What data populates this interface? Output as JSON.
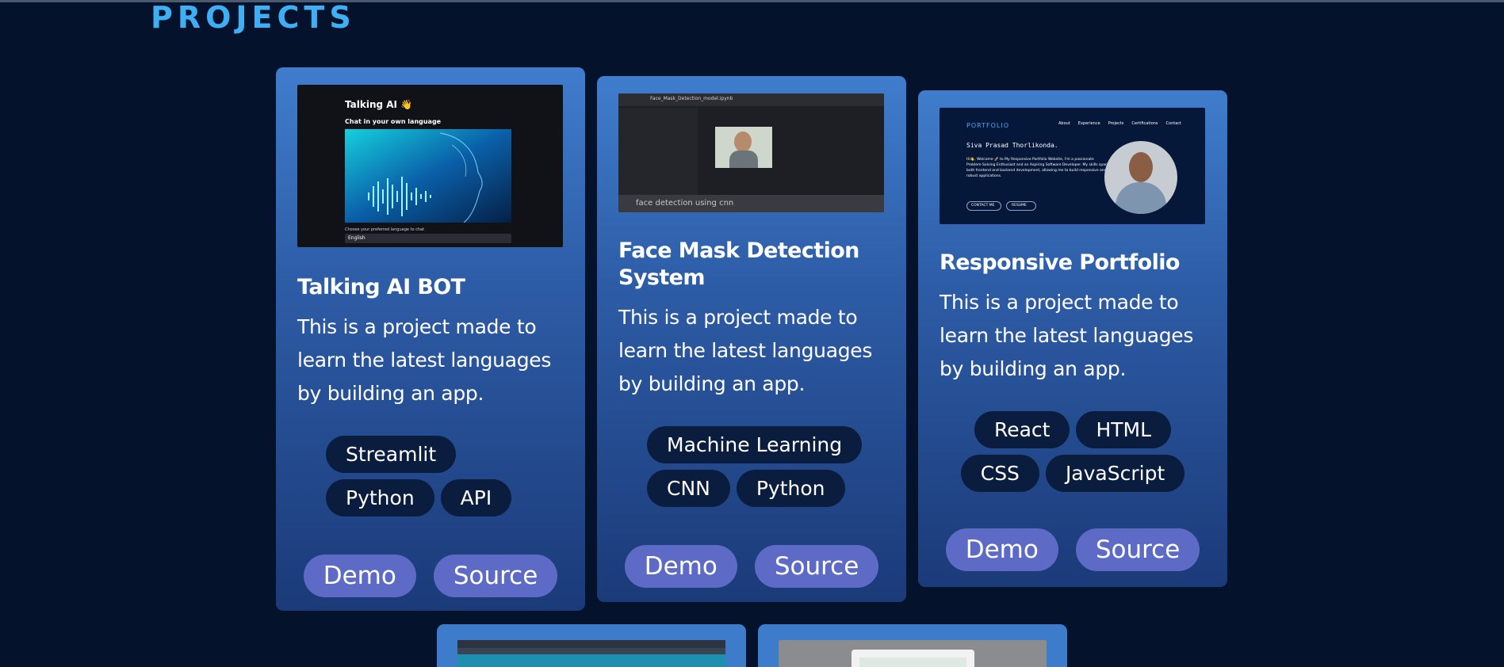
{
  "section": {
    "title": "PROJECTS"
  },
  "projects": [
    {
      "title": "Talking AI BOT",
      "description": "This is a project made to learn the latest languages by building an app.",
      "tags": [
        "Streamlit",
        "Python",
        "API"
      ],
      "demo_label": "Demo",
      "source_label": "Source",
      "preview": {
        "heading": "Talking AI 👋",
        "subheading": "Chat in your own language",
        "choose_label": "Choose your preferred language to chat",
        "select_value": "English"
      }
    },
    {
      "title": "Face Mask Detection System",
      "description": "This is a project made to learn the latest languages by building an app.",
      "tags": [
        "Machine Learning",
        "CNN",
        "Python"
      ],
      "demo_label": "Demo",
      "source_label": "Source",
      "preview": {
        "filename": "Face_Mask_Detection_model.ipynb",
        "caption": "face detection using cnn"
      }
    },
    {
      "title": "Responsive Portfolio",
      "description": "This is a project made to learn the latest languages by building an app.",
      "tags": [
        "React",
        "HTML",
        "CSS",
        "JavaScript"
      ],
      "demo_label": "Demo",
      "source_label": "Source",
      "preview": {
        "brand": "PORTFOLIO",
        "nav": [
          "About",
          "Experience",
          "Projects",
          "Certifications",
          "Contact"
        ],
        "name": "Siva Prasad Thorlikonda.",
        "intro": "Hi👋, Welcome 🚀 to My Responsive Portfolio Website, I'm a passionate Problem-Solving Enthusiast and an Aspiring Software Developer. My skills span both frontend and backend development, allowing me to build responsive and robust applications.",
        "contact_btn": "CONTACT ME",
        "resume_btn": "RESUME"
      }
    }
  ],
  "colors": {
    "background": "#04132b",
    "title": "#3eaef5",
    "card_top": "#3f7dcc",
    "card_bottom": "#1b3a78",
    "tag_bg": "#0b1d3f",
    "button_bg": "#5d6bc7"
  }
}
